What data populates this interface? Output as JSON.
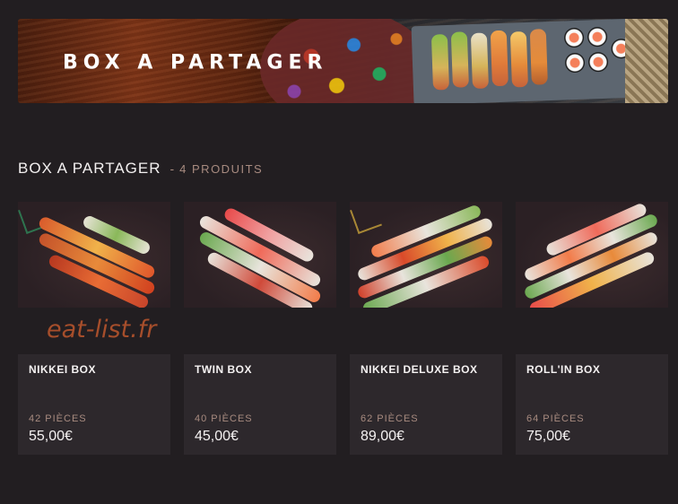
{
  "banner": {
    "title": "BOX A PARTAGER"
  },
  "section": {
    "title": "BOX A PARTAGER",
    "separator": "-",
    "count": "4 PRODUITS"
  },
  "products": [
    {
      "name": "NIKKEI BOX",
      "pieces": "42 PIÈCES",
      "price": "55,00€"
    },
    {
      "name": "TWIN BOX",
      "pieces": "40 PIÈCES",
      "price": "45,00€"
    },
    {
      "name": "NIKKEI DELUXE BOX",
      "pieces": "62 PIÈCES",
      "price": "89,00€"
    },
    {
      "name": "ROLL'IN BOX",
      "pieces": "64 PIÈCES",
      "price": "75,00€"
    }
  ],
  "watermark": "eat-list.fr",
  "colors": {
    "background": "#221e21",
    "card": "#2d282c",
    "muted": "#a88b80",
    "watermark": "#a64e2b"
  }
}
